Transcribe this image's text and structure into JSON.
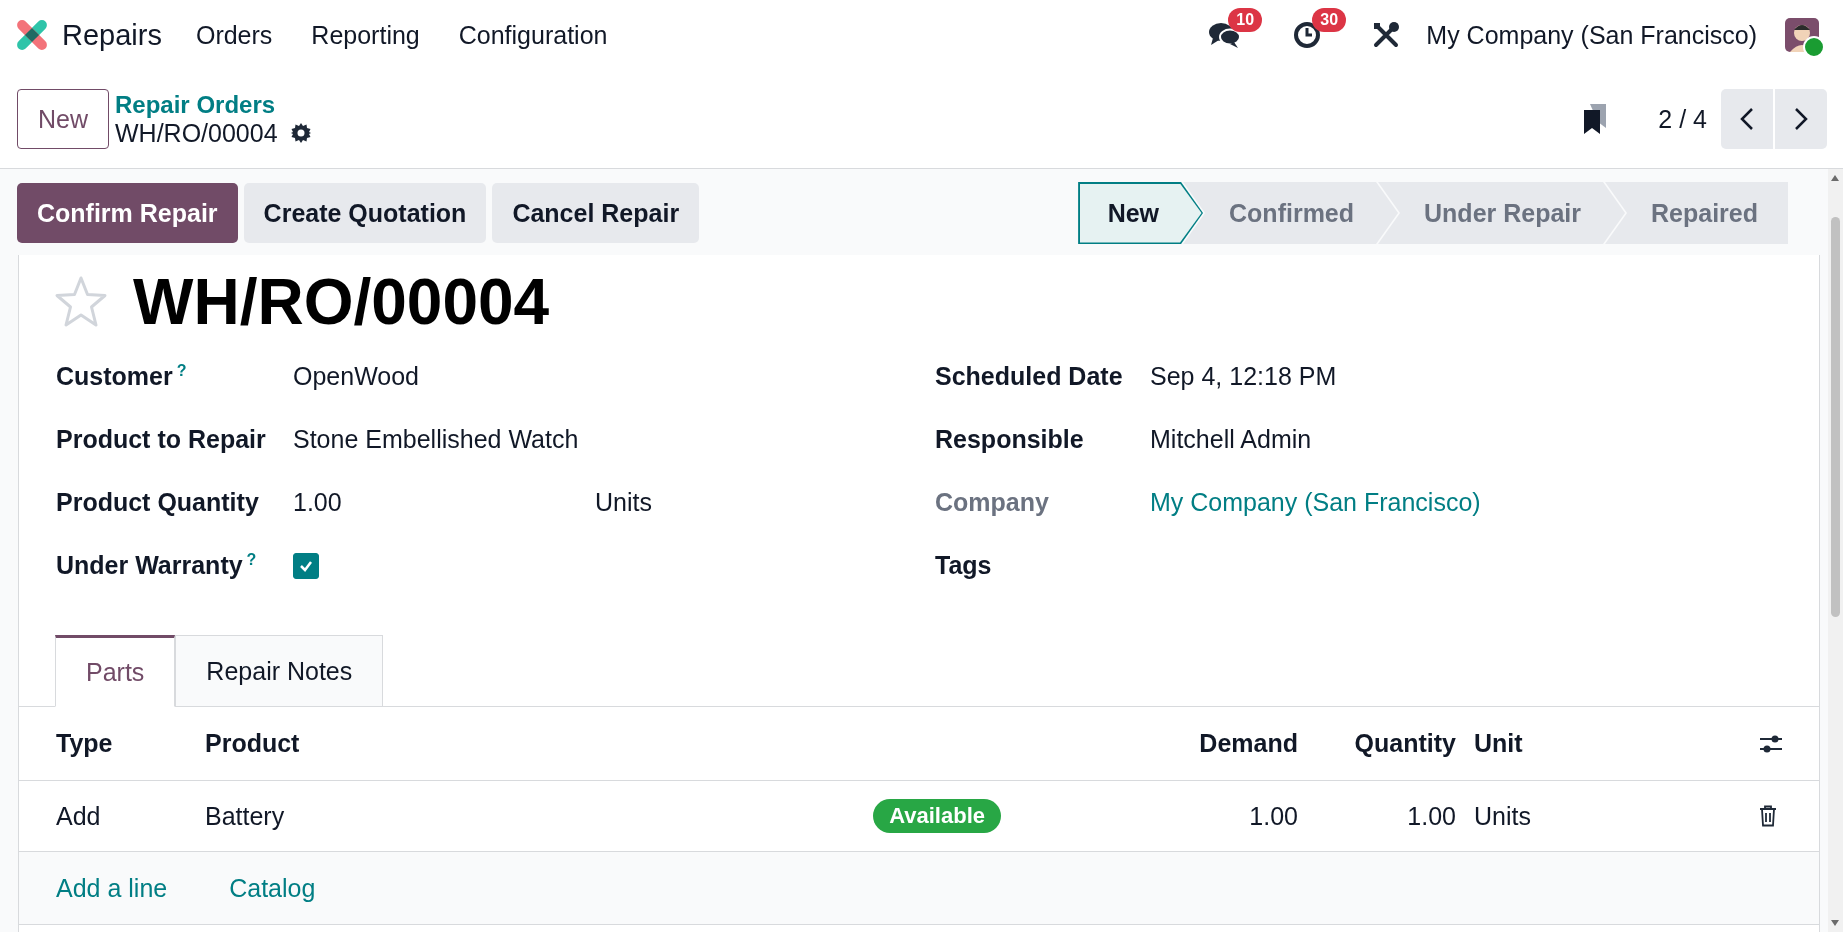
{
  "navbar": {
    "app_name": "Repairs",
    "menu": [
      "Orders",
      "Reporting",
      "Configuration"
    ],
    "messages_count": "10",
    "activities_count": "30",
    "company": "My Company (San Francisco)",
    "user_online": true
  },
  "breadcrumb": {
    "new_button": "New",
    "parent": "Repair Orders",
    "current": "WH/RO/00004"
  },
  "pager": {
    "value": "2 / 4"
  },
  "actions": [
    {
      "label": "Confirm Repair",
      "primary": true
    },
    {
      "label": "Create Quotation",
      "primary": false
    },
    {
      "label": "Cancel Repair",
      "primary": false
    }
  ],
  "stages": [
    {
      "label": "New",
      "selected": true
    },
    {
      "label": "Confirmed",
      "selected": false
    },
    {
      "label": "Under Repair",
      "selected": false
    },
    {
      "label": "Repaired",
      "selected": false
    }
  ],
  "record": {
    "starred": false,
    "title": "WH/RO/00004"
  },
  "left_fields": [
    {
      "kind": "text",
      "label": "Customer",
      "help": "?",
      "value": "OpenWood"
    },
    {
      "kind": "text",
      "label": "Product to Repair",
      "value": "Stone Embellished Watch"
    },
    {
      "kind": "text",
      "label": "Product Quantity",
      "value": "1.00",
      "unit": "Units"
    },
    {
      "kind": "checkbox",
      "label": "Under Warranty",
      "help": "?",
      "checked": true
    }
  ],
  "right_fields": [
    {
      "kind": "text",
      "label": "Scheduled Date",
      "label_muted": false,
      "value": "Sep 4, 12:18 PM"
    },
    {
      "kind": "text",
      "label": "Responsible",
      "label_muted": false,
      "value": "Mitchell Admin"
    },
    {
      "kind": "link",
      "label": "Company",
      "label_muted": true,
      "value": "My Company (San Francisco)"
    },
    {
      "kind": "text",
      "label": "Tags",
      "label_muted": false
    }
  ],
  "tabs": [
    {
      "label": "Parts",
      "selected": true
    },
    {
      "label": "Repair Notes",
      "selected": false
    }
  ],
  "table": {
    "columns": [
      "Type",
      "Product",
      "Demand",
      "Quantity",
      "Unit"
    ],
    "rows": [
      {
        "type": "Add",
        "product": "Battery",
        "status": "Available",
        "demand": "1.00",
        "quantity": "1.00",
        "unit": "Units"
      }
    ],
    "footer_links": [
      "Add a line",
      "Catalog"
    ]
  }
}
